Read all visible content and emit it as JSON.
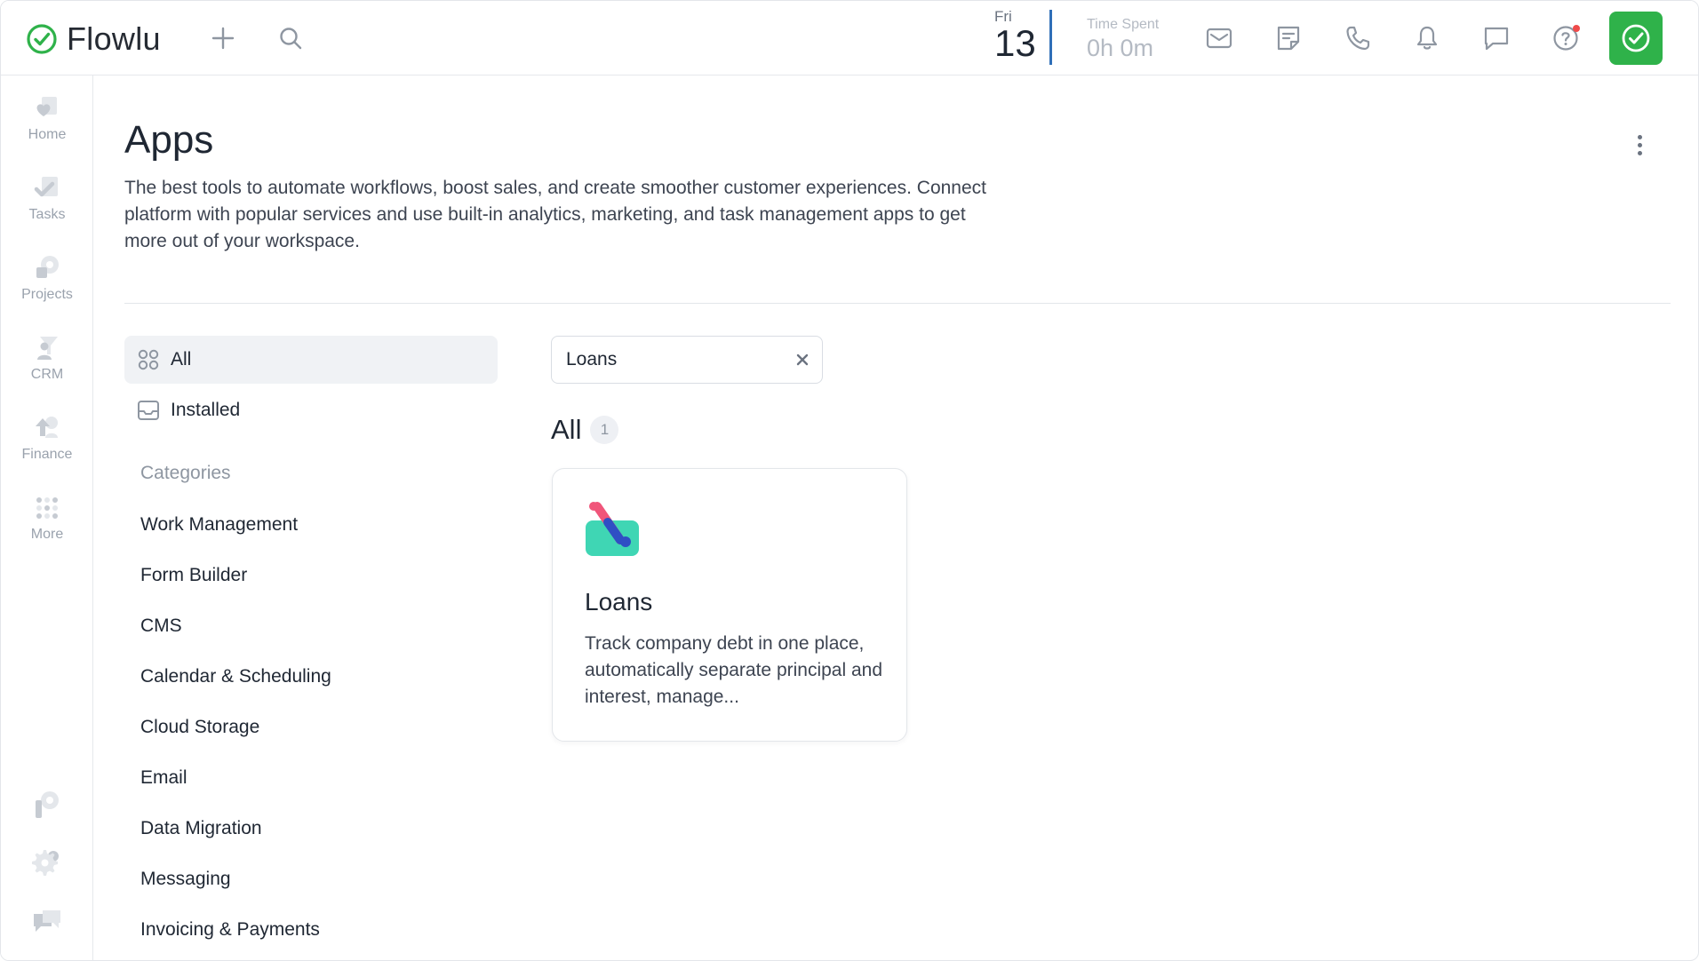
{
  "brand": {
    "name": "Flowlu",
    "accent": "#2fb24a"
  },
  "topbar": {
    "date_day": "Fri",
    "date_num": "13",
    "time_label": "Time Spent",
    "time_value": "0h 0m",
    "icons": [
      "plus-icon",
      "search-icon",
      "mail-icon",
      "notes-icon",
      "phone-icon",
      "bell-icon",
      "chat-icon",
      "help-icon",
      "check-icon"
    ]
  },
  "sidebar": {
    "items": [
      {
        "label": "Home",
        "icon": "home-icon"
      },
      {
        "label": "Tasks",
        "icon": "tasks-icon"
      },
      {
        "label": "Projects",
        "icon": "projects-icon"
      },
      {
        "label": "CRM",
        "icon": "crm-icon"
      },
      {
        "label": "Finance",
        "icon": "finance-icon"
      },
      {
        "label": "More",
        "icon": "more-grid-icon"
      }
    ],
    "bottom_icons": [
      "apps-icon",
      "settings-icon",
      "support-icon"
    ]
  },
  "page": {
    "title": "Apps",
    "description": "The best tools to automate workflows, boost sales, and create smoother customer experiences. Connect platform with popular services and use built-in analytics, marketing, and task management apps to get more out of your workspace."
  },
  "filters": {
    "all_label": "All",
    "installed_label": "Installed",
    "categories_heading": "Categories",
    "categories": [
      "Work Management",
      "Form Builder",
      "CMS",
      "Calendar & Scheduling",
      "Cloud Storage",
      "Email",
      "Data Migration",
      "Messaging",
      "Invoicing & Payments"
    ]
  },
  "search": {
    "value": "Loans"
  },
  "results": {
    "title": "All",
    "count": "1",
    "apps": [
      {
        "name": "Loans",
        "description": "Track company debt in one place, automatically separate principal and interest, manage..."
      }
    ]
  }
}
